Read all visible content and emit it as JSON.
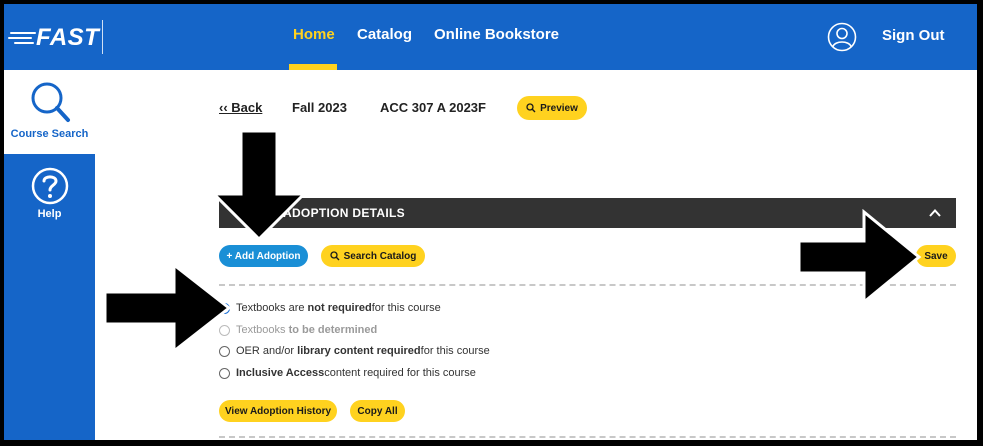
{
  "header": {
    "logo_text": "FAST",
    "nav": [
      {
        "label": "Home",
        "active": true
      },
      {
        "label": "Catalog",
        "active": false
      },
      {
        "label": "Online Bookstore",
        "active": false
      }
    ],
    "sign_out_label": "Sign Out",
    "accent_color": "#ffd21f",
    "brand_color": "#1565c8"
  },
  "sidebar": {
    "items": [
      {
        "label": "Course Search",
        "icon": "search-icon",
        "active": true
      },
      {
        "label": "Help",
        "icon": "help-icon",
        "active": false
      }
    ]
  },
  "course_header": {
    "back_label": "‹‹ Back",
    "term": "Fall 2023",
    "course": "ACC 307 A 2023F",
    "preview_label": "Preview"
  },
  "adoption": {
    "section_title": "ADOPTION DETAILS",
    "add_label": "+ Add Adoption",
    "search_label": "Search Catalog",
    "save_label": "Save",
    "options": [
      {
        "pre": "Textbooks are ",
        "bold": "not required",
        "post": " for this course",
        "checked": true,
        "disabled": false
      },
      {
        "pre": "Textbooks ",
        "bold": "to be determined",
        "post": "",
        "checked": false,
        "disabled": true
      },
      {
        "pre": "OER and/or ",
        "bold": "library content required",
        "post": " for this course",
        "checked": false,
        "disabled": false
      },
      {
        "pre": "",
        "bold": "Inclusive Access",
        "post": " content required for this course",
        "checked": false,
        "disabled": false
      }
    ],
    "history_label": "View Adoption History",
    "copy_label": "Copy All"
  }
}
